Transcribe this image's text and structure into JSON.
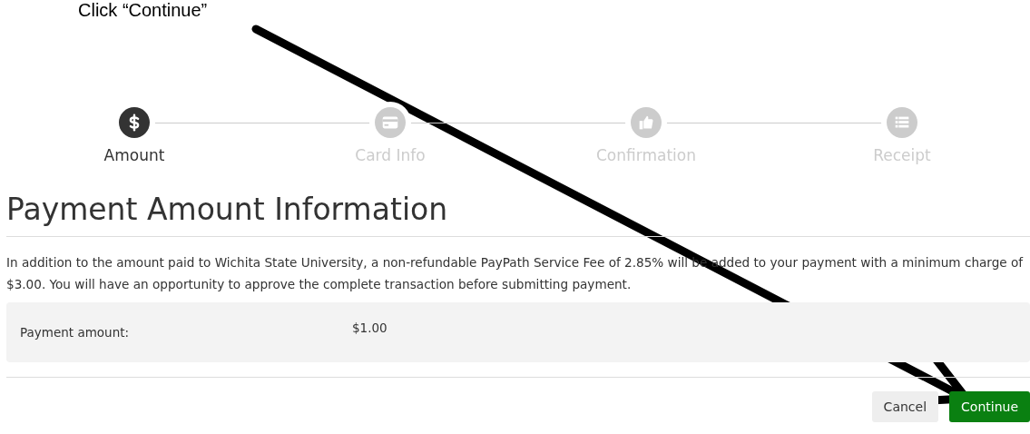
{
  "annotation": {
    "text": "Click “Continue”"
  },
  "steps": [
    {
      "label": "Amount",
      "selected": true
    },
    {
      "label": "Card Info",
      "selected": false
    },
    {
      "label": "Confirmation",
      "selected": false
    },
    {
      "label": "Receipt",
      "selected": false
    }
  ],
  "title": "Payment Amount Information",
  "notice": "In addition to the amount paid to Wichita State University, a non-refundable PayPath Service Fee of 2.85% will be added to your payment with a minimum charge of $3.00. You will have an opportunity to approve the complete transaction before submitting payment.",
  "fields": [
    {
      "label": "Payment amount:",
      "value": "$1.00"
    }
  ],
  "buttons": [
    {
      "label": "Cancel",
      "kind": "secondary"
    },
    {
      "label": "Continue",
      "kind": "primary"
    }
  ]
}
